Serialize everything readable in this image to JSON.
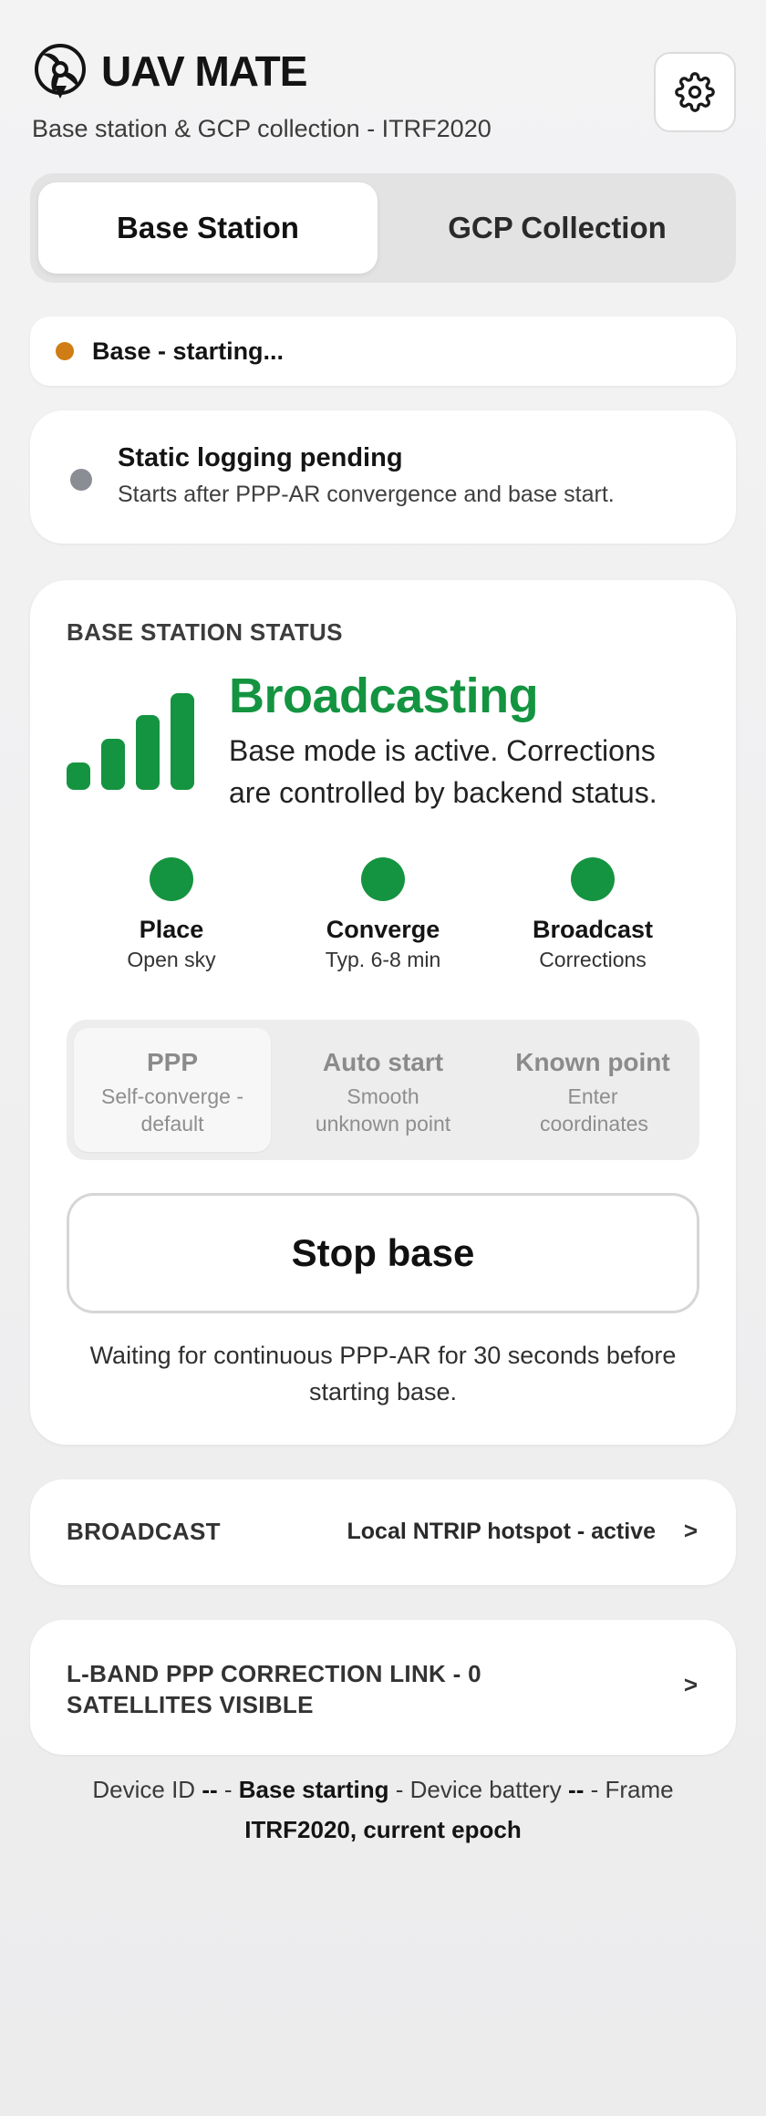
{
  "header": {
    "app_name": "UAV MATE",
    "subtitle": "Base station & GCP collection - ITRF2020",
    "logo_icon": "drone-propeller-icon",
    "settings_icon": "gear-icon"
  },
  "tabs": [
    {
      "label": "Base Station",
      "active": true
    },
    {
      "label": "GCP Collection",
      "active": false
    }
  ],
  "status_pill": {
    "text": "Base - starting...",
    "dot_color": "#cf7d14"
  },
  "logging": {
    "title": "Static logging pending",
    "subtitle": "Starts after PPP-AR convergence and base start.",
    "dot_color": "#8a8d93"
  },
  "base_status": {
    "heading": "BASE STATION STATUS",
    "state": "Broadcasting",
    "description": "Base mode is active. Corrections are controlled by backend status.",
    "accent_color": "#149440",
    "steps": [
      {
        "label": "Place",
        "sub": "Open sky"
      },
      {
        "label": "Converge",
        "sub": "Typ. 6-8 min"
      },
      {
        "label": "Broadcast",
        "sub": "Corrections"
      }
    ],
    "modes": [
      {
        "title": "PPP",
        "sub": "Self-converge - default",
        "selected": true
      },
      {
        "title": "Auto start",
        "sub": "Smooth unknown point",
        "selected": false
      },
      {
        "title": "Known point",
        "sub": "Enter coordinates",
        "selected": false
      }
    ],
    "stop_label": "Stop base",
    "wait_text": "Waiting for continuous PPP-AR for 30 seconds before starting base."
  },
  "broadcast": {
    "label": "BROADCAST",
    "value": "Local NTRIP hotspot - active",
    "chevron": ">"
  },
  "lband": {
    "label": "L-BAND PPP CORRECTION LINK - 0 SATELLITES VISIBLE",
    "chevron": ">"
  },
  "footer": {
    "device_id_label": "Device ID",
    "device_id_value": "--",
    "sep": " - ",
    "state": "Base starting",
    "battery_label": "Device battery",
    "battery_value": "--",
    "frame_label": "Frame",
    "frame_value": "ITRF2020, current epoch"
  }
}
